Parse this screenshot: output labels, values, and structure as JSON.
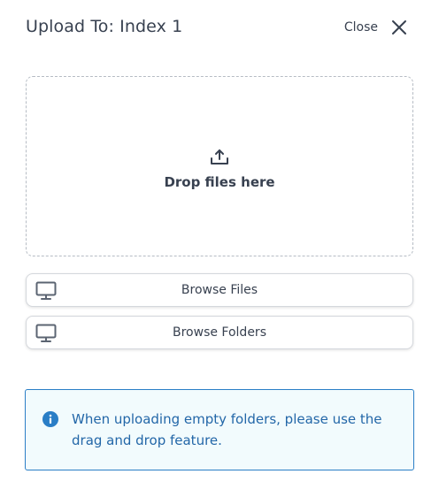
{
  "header": {
    "title": "Upload To: Index 1",
    "close_label": "Close"
  },
  "dropzone": {
    "text": "Drop files here",
    "icon": "upload-icon"
  },
  "buttons": {
    "browse_files": "Browse Files",
    "browse_folders": "Browse Folders",
    "icon": "monitor-icon"
  },
  "info": {
    "icon": "info-icon",
    "text": "When uploading empty folders, please use the drag and drop feature."
  },
  "colors": {
    "text": "#384150",
    "info_border": "#2a7ec6",
    "info_text": "#2367a8",
    "info_background": "#f2fbfd"
  }
}
